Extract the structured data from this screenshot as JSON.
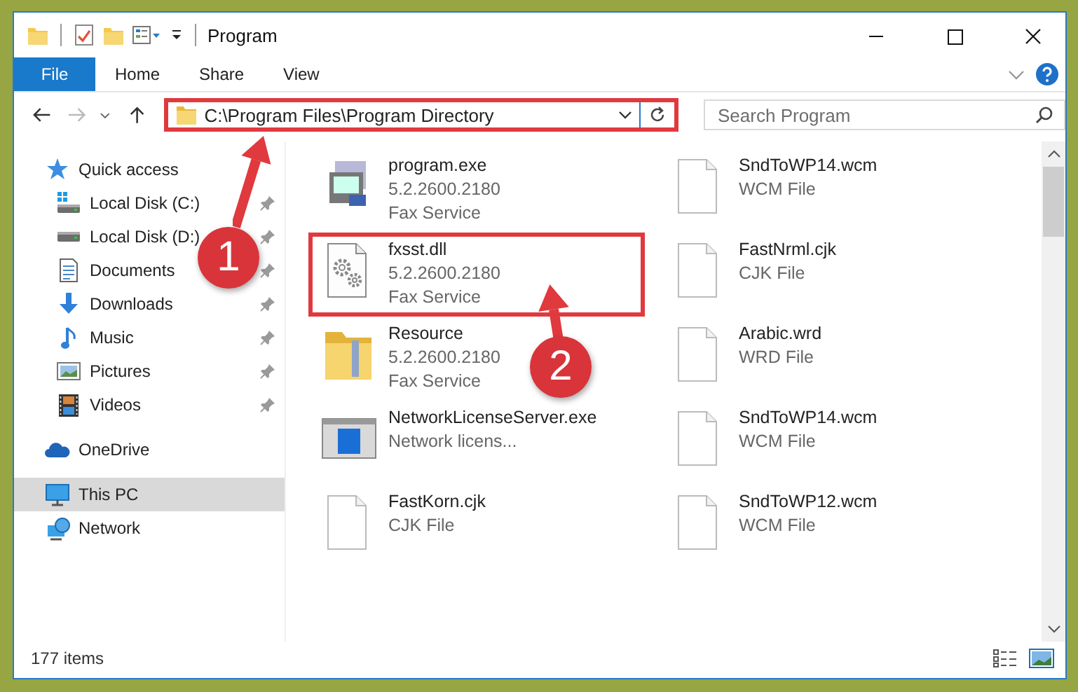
{
  "window": {
    "title": "Program"
  },
  "ribbon_tabs": [
    {
      "label": "File",
      "kind": "file"
    },
    {
      "label": "Home",
      "kind": "tab"
    },
    {
      "label": "Share",
      "kind": "tab"
    },
    {
      "label": "View",
      "kind": "tab"
    }
  ],
  "address_bar": {
    "value": "C:\\Program Files\\Program Directory",
    "highlighted": true
  },
  "search": {
    "placeholder": "Search Program"
  },
  "navigation": [
    {
      "label": "Quick access",
      "kind": "star",
      "selected": false,
      "children": [
        {
          "label": "Local Disk (C:)",
          "kind": "system-drive",
          "pinned": true,
          "selected": false
        },
        {
          "label": "Local Disk (D:)",
          "kind": "drive",
          "pinned": true,
          "selected": false
        },
        {
          "label": "Documents",
          "kind": "documents",
          "pinned": true,
          "selected": false
        },
        {
          "label": "Downloads",
          "kind": "downloads",
          "pinned": true,
          "selected": false
        },
        {
          "label": "Music",
          "kind": "music",
          "pinned": true,
          "selected": false
        },
        {
          "label": "Pictures",
          "kind": "pictures",
          "pinned": true,
          "selected": false
        },
        {
          "label": "Videos",
          "kind": "videos",
          "pinned": true,
          "selected": false
        }
      ]
    },
    {
      "label": "OneDrive",
      "kind": "cloud",
      "selected": false
    },
    {
      "label": "This PC",
      "kind": "computer",
      "selected": true
    },
    {
      "label": "Network",
      "kind": "network",
      "selected": false
    }
  ],
  "files": [
    {
      "name": "program.exe",
      "details": [
        "5.2.2600.2180",
        "Fax Service"
      ],
      "kind": "installer",
      "highlighted": false
    },
    {
      "name": "SndToWP14.wcm",
      "details": [
        "WCM File"
      ],
      "kind": "blank",
      "highlighted": false
    },
    {
      "name": "fxsst.dll",
      "details": [
        "5.2.2600.2180",
        "Fax Service"
      ],
      "kind": "library",
      "highlighted": true
    },
    {
      "name": "FastNrml.cjk",
      "details": [
        "CJK File"
      ],
      "kind": "blank",
      "highlighted": false
    },
    {
      "name": "Resource",
      "details": [
        "5.2.2600.2180",
        "Fax Service"
      ],
      "kind": "folder",
      "highlighted": false
    },
    {
      "name": "Arabic.wrd",
      "details": [
        "WRD File"
      ],
      "kind": "blank",
      "highlighted": false
    },
    {
      "name": "NetworkLicenseServer.exe",
      "details": [
        "Network licens..."
      ],
      "kind": "application",
      "highlighted": false
    },
    {
      "name": "SndToWP14.wcm",
      "details": [
        "WCM File"
      ],
      "kind": "blank",
      "highlighted": false
    },
    {
      "name": "FastKorn.cjk",
      "details": [
        "CJK File"
      ],
      "kind": "blank",
      "highlighted": false
    },
    {
      "name": "SndToWP12.wcm",
      "details": [
        "WCM File"
      ],
      "kind": "blank",
      "highlighted": false
    }
  ],
  "status_bar": {
    "item_count": "177 items"
  },
  "annotations": [
    {
      "label": "1"
    },
    {
      "label": "2"
    }
  ]
}
